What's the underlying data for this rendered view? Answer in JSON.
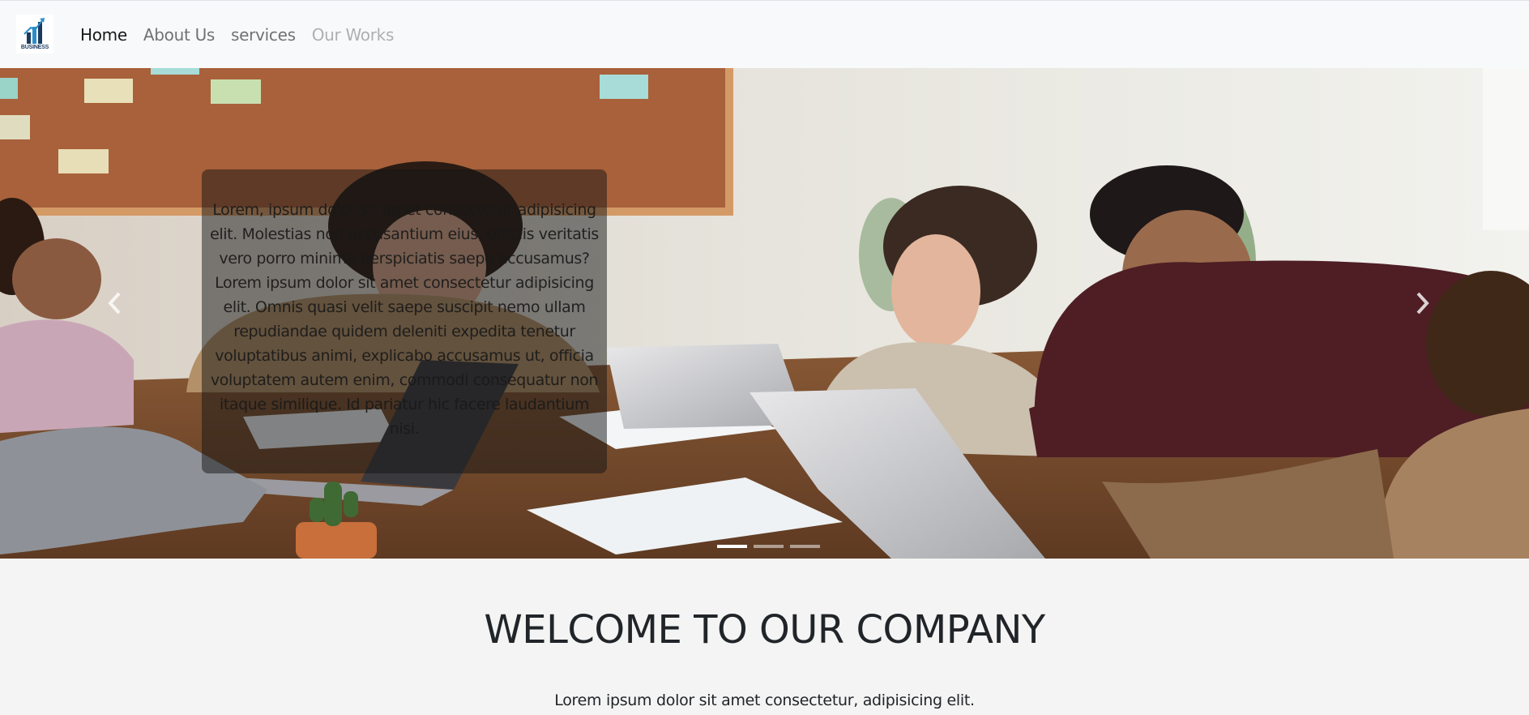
{
  "brand": {
    "logo_text": "BUSINESS",
    "logo_icon": "bar-chart-growth-icon",
    "colors": {
      "bar_dark": "#1c3a5e",
      "bar_light": "#2b8ec8"
    }
  },
  "nav": {
    "items": [
      {
        "label": "Home",
        "state": "active"
      },
      {
        "label": "About Us",
        "state": "default"
      },
      {
        "label": "services",
        "state": "default"
      },
      {
        "label": "Our Works",
        "state": "disabled"
      }
    ]
  },
  "carousel": {
    "image": "office-team-meeting-photo",
    "caption": "Lorem, ipsum dolor sit amet consectetur adipisicing elit. Molestias non accusantium eius, officiis veritatis vero porro minima perspiciatis saepe accusamus? Lorem ipsum dolor sit amet consectetur adipisicing elit. Omnis quasi velit saepe suscipit nemo ullam repudiandae quidem deleniti expedita tenetur voluptatibus animi, explicabo accusamus ut, officia voluptatem autem enim, commodi consequatur non itaque similique. Id pariatur hic facere laudantium nisi.",
    "prev_icon": "chevron-left-icon",
    "next_icon": "chevron-right-icon",
    "slide_count": 3,
    "active_slide": 1
  },
  "welcome": {
    "title": "WELCOME TO OUR COMPANY",
    "text": "Lorem ipsum dolor sit amet consectetur, adipisicing elit."
  }
}
